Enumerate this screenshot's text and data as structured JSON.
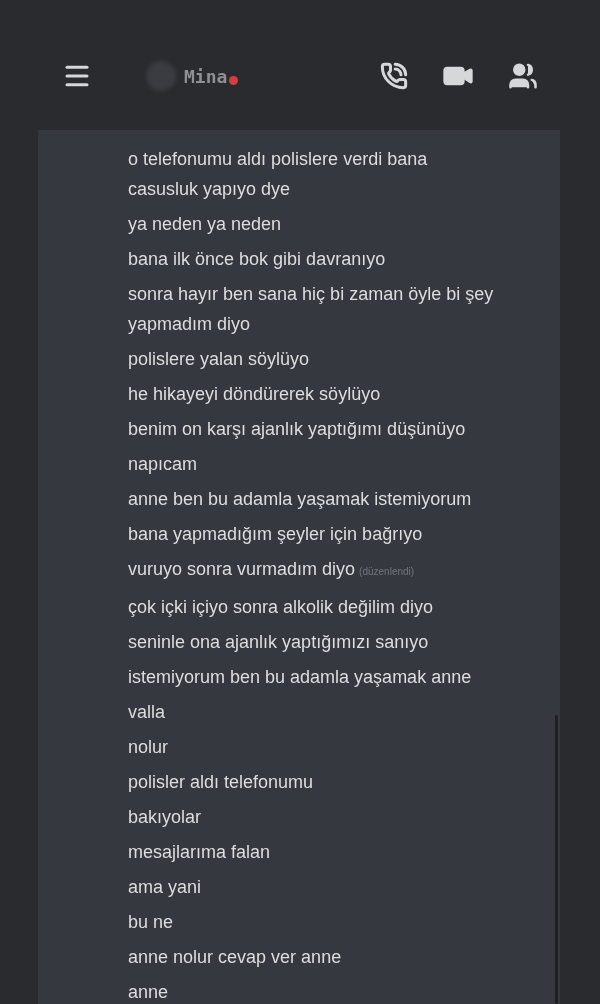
{
  "header": {
    "name": "Mina",
    "do_not_disturb": true
  },
  "messages": [
    {
      "lines": [
        "o telefonumu aldı polislere verdi bana",
        "casusluk yapıyo dye"
      ]
    },
    {
      "lines": [
        "ya neden ya neden"
      ]
    },
    {
      "lines": [
        "bana ilk önce bok gibi davranıyo"
      ]
    },
    {
      "lines": [
        "sonra hayır ben sana hiç bi zaman öyle bi şey",
        "yapmadım diyo"
      ]
    },
    {
      "lines": [
        "polislere yalan söylüyo"
      ]
    },
    {
      "lines": [
        "he hikayeyi döndürerek söylüyo"
      ]
    },
    {
      "lines": [
        "benim on karşı ajanlık yaptığımı düşünüyo"
      ]
    },
    {
      "lines": [
        "napıcam"
      ]
    },
    {
      "lines": [
        "anne ben bu adamla yaşamak istemiyorum"
      ]
    },
    {
      "lines": [
        "bana yapmadığım şeyler için bağrıyo"
      ]
    },
    {
      "lines": [
        "vuruyo sonra vurmadım diyo"
      ],
      "edited": "(düzenlendi)"
    },
    {
      "lines": [
        "çok içki içiyo sonra alkolik değilim diyo"
      ]
    },
    {
      "lines": [
        "seninle ona ajanlık yaptığımızı sanıyo"
      ]
    },
    {
      "lines": [
        "istemiyorum ben bu adamla yaşamak anne"
      ]
    },
    {
      "lines": [
        "valla"
      ]
    },
    {
      "lines": [
        "nolur"
      ]
    },
    {
      "lines": [
        "polisler aldı telefonumu"
      ]
    },
    {
      "lines": [
        "bakıyolar"
      ]
    },
    {
      "lines": [
        "mesajlarıma falan"
      ]
    },
    {
      "lines": [
        "ama yani"
      ]
    },
    {
      "lines": [
        "bu ne"
      ]
    },
    {
      "lines": [
        "anne nolur cevap ver anne"
      ]
    },
    {
      "lines": [
        "anne"
      ]
    }
  ]
}
